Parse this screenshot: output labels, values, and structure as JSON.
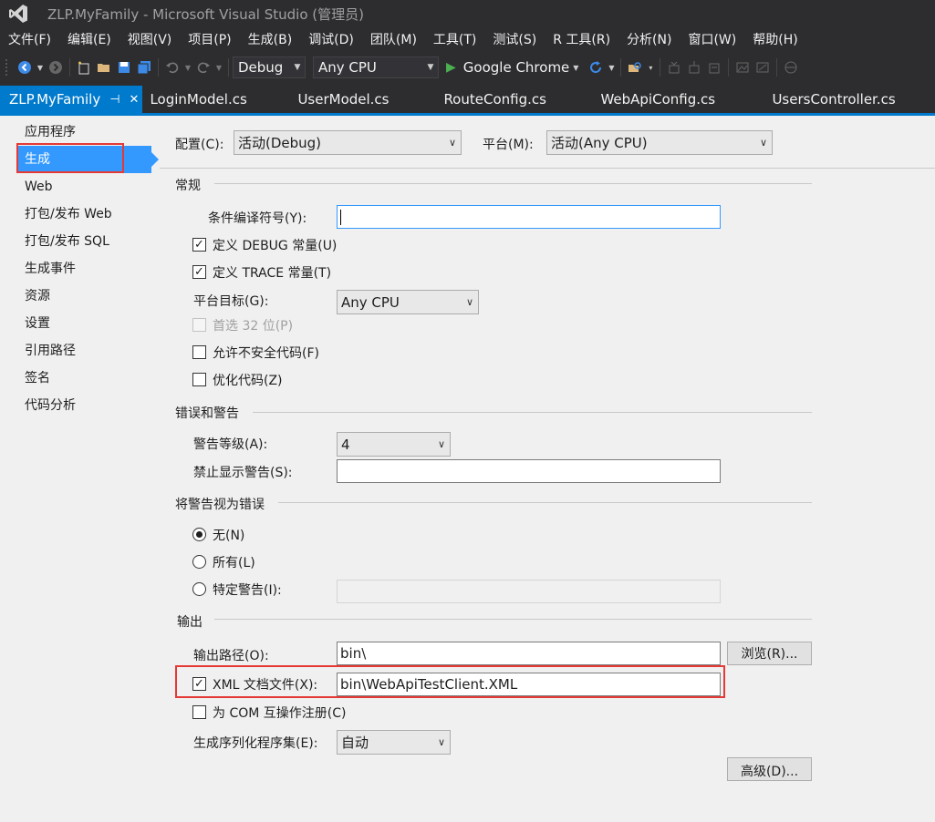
{
  "window": {
    "title": "ZLP.MyFamily - Microsoft Visual Studio (管理员)"
  },
  "menu": [
    "文件(F)",
    "编辑(E)",
    "视图(V)",
    "项目(P)",
    "生成(B)",
    "调试(D)",
    "团队(M)",
    "工具(T)",
    "测试(S)",
    "R 工具(R)",
    "分析(N)",
    "窗口(W)",
    "帮助(H)"
  ],
  "toolbar": {
    "config": "Debug",
    "platform": "Any CPU",
    "run_target": "Google Chrome"
  },
  "tabs": [
    {
      "label": "ZLP.MyFamily",
      "active": true
    },
    {
      "label": "LoginModel.cs"
    },
    {
      "label": "UserModel.cs"
    },
    {
      "label": "RouteConfig.cs"
    },
    {
      "label": "WebApiConfig.cs"
    },
    {
      "label": "UsersController.cs"
    }
  ],
  "nav": {
    "items": [
      "应用程序",
      "生成",
      "Web",
      "打包/发布 Web",
      "打包/发布 SQL",
      "生成事件",
      "资源",
      "设置",
      "引用路径",
      "签名",
      "代码分析"
    ],
    "selected": "生成"
  },
  "header": {
    "config_label": "配置(C):",
    "config_value": "活动(Debug)",
    "platform_label": "平台(M):",
    "platform_value": "活动(Any CPU)"
  },
  "general": {
    "title": "常规",
    "symbols_label": "条件编译符号(Y):",
    "symbols_value": "",
    "define_debug": {
      "label": "定义 DEBUG 常量(U)",
      "checked": true
    },
    "define_trace": {
      "label": "定义 TRACE 常量(T)",
      "checked": true
    },
    "platform_target_label": "平台目标(G):",
    "platform_target_value": "Any CPU",
    "prefer32": {
      "label": "首选 32 位(P)",
      "checked": false,
      "disabled": true
    },
    "unsafe": {
      "label": "允许不安全代码(F)",
      "checked": false
    },
    "optimize": {
      "label": "优化代码(Z)",
      "checked": false
    }
  },
  "errors": {
    "title": "错误和警告",
    "level_label": "警告等级(A):",
    "level_value": "4",
    "suppress_label": "禁止显示警告(S):",
    "suppress_value": ""
  },
  "treat_errors": {
    "title": "将警告视为错误",
    "none": "无(N)",
    "all": "所有(L)",
    "specific": "特定警告(I):",
    "selected": "none"
  },
  "output": {
    "title": "输出",
    "path_label": "输出路径(O):",
    "path_value": "bin\\",
    "browse": "浏览(R)...",
    "xml_doc": {
      "label": "XML 文档文件(X):",
      "checked": true
    },
    "xml_doc_value": "bin\\WebApiTestClient.XML",
    "com": {
      "label": "为 COM 互操作注册(C)",
      "checked": false
    },
    "serialization_label": "生成序列化程序集(E):",
    "serialization_value": "自动",
    "advanced": "高级(D)..."
  },
  "colors": {
    "accent": "#007acc",
    "nav_selected": "#3399ff",
    "highlight_box": "#e53935",
    "chrome": "#2d2d30"
  }
}
